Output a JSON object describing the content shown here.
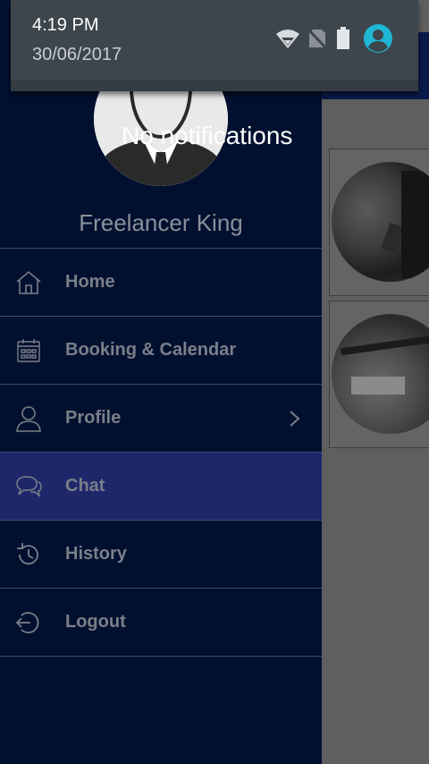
{
  "status_bar": {
    "time": "4:19 PM",
    "date": "30/06/2017",
    "icons": [
      "wifi-icon",
      "no-sim-icon",
      "battery-icon",
      "account-icon"
    ],
    "account_color": "#1fb7d4"
  },
  "notifications": {
    "empty_text": "No notifications"
  },
  "drawer": {
    "username": "Freelancer King",
    "menu": [
      {
        "label": "Home",
        "icon": "home-icon"
      },
      {
        "label": "Booking & Calendar",
        "icon": "calendar-icon"
      },
      {
        "label": "Profile",
        "icon": "person-icon",
        "has_submenu": true
      },
      {
        "label": "Chat",
        "icon": "chat-icon",
        "active": true
      },
      {
        "label": "History",
        "icon": "history-icon"
      },
      {
        "label": "Logout",
        "icon": "logout-icon"
      }
    ],
    "background": "#021030",
    "active_background": "#1d276a"
  },
  "main": {
    "cards": [
      "photo-card",
      "photo-card"
    ]
  }
}
